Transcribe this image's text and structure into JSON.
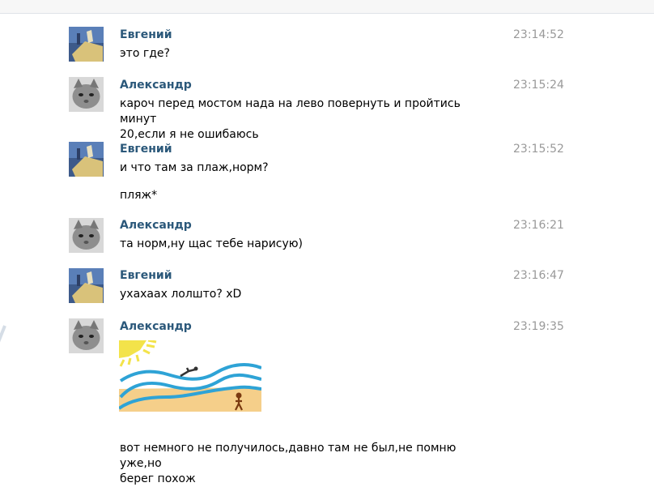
{
  "messages": [
    {
      "author": "Евгений",
      "time": "23:14:52",
      "avatar": "blue-avatar",
      "lines": [
        "это где?"
      ]
    },
    {
      "author": "Александр",
      "time": "23:15:24",
      "avatar": "cat-avatar",
      "lines": [
        "кароч перед мостом нада на лево повернуть и пройтись минут",
        "20,если я не ошибаюсь"
      ]
    },
    {
      "author": "Евгений",
      "time": "23:15:52",
      "avatar": "blue-avatar",
      "lines": [
        "и что там за плаж,норм?"
      ],
      "extra": "пляж*"
    },
    {
      "author": "Александр",
      "time": "23:16:21",
      "avatar": "cat-avatar",
      "lines": [
        "та норм,ну щас тебе нарисую)"
      ]
    },
    {
      "author": "Евгений",
      "time": "23:16:47",
      "avatar": "blue-avatar",
      "lines": [
        "ухахаах лолшто? xD"
      ]
    },
    {
      "author": "Александр",
      "time": "23:19:35",
      "avatar": "cat-avatar",
      "lines": [
        "вот немного не получилось,давно там не был,не помню уже,но",
        "берег похож"
      ],
      "attachment": "beach-drawing"
    }
  ],
  "colors": {
    "author": "#2b587a",
    "time": "#999999",
    "sun": "#f3e34a",
    "sea": "#2ea3d6",
    "sand": "#f5cf8a",
    "figure": "#7a3a10"
  }
}
